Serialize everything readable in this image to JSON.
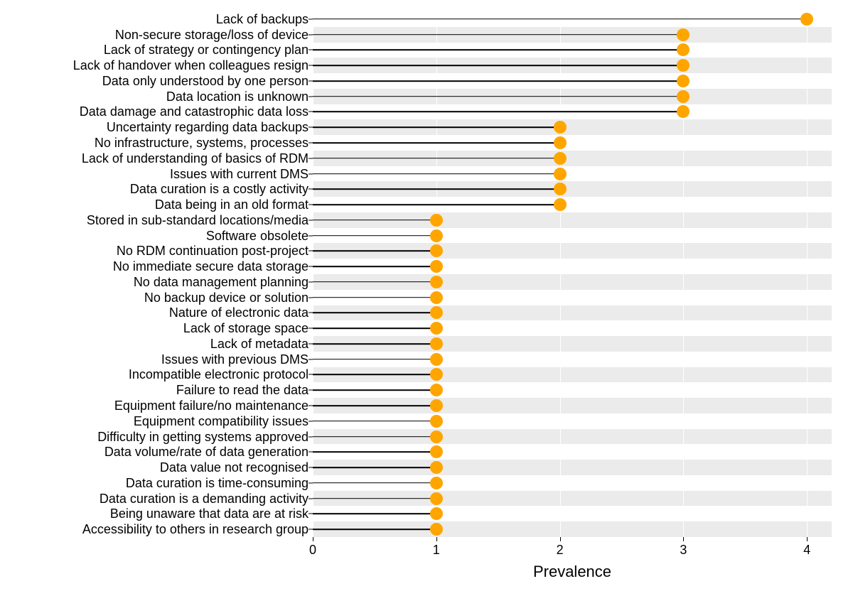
{
  "chart_data": {
    "type": "lollipop-bar",
    "xlabel": "Prevalence",
    "ylabel": "",
    "xlim": [
      0,
      4.2
    ],
    "xticks": [
      0,
      1,
      2,
      3,
      4
    ],
    "series": [
      {
        "label": "Lack of backups",
        "value": 4
      },
      {
        "label": "Non-secure storage/loss of device",
        "value": 3
      },
      {
        "label": "Lack of strategy or contingency plan",
        "value": 3
      },
      {
        "label": "Lack of handover when colleagues resign",
        "value": 3
      },
      {
        "label": "Data only understood by one person",
        "value": 3
      },
      {
        "label": "Data location is unknown",
        "value": 3
      },
      {
        "label": "Data damage and catastrophic data loss",
        "value": 3
      },
      {
        "label": "Uncertainty regarding data backups",
        "value": 2
      },
      {
        "label": "No infrastructure, systems, processes",
        "value": 2
      },
      {
        "label": "Lack of understanding of basics of RDM",
        "value": 2
      },
      {
        "label": "Issues with current DMS",
        "value": 2
      },
      {
        "label": "Data curation is a costly activity",
        "value": 2
      },
      {
        "label": "Data being in an old format",
        "value": 2
      },
      {
        "label": "Stored in sub-standard locations/media",
        "value": 1
      },
      {
        "label": "Software obsolete",
        "value": 1
      },
      {
        "label": "No RDM continuation post-project",
        "value": 1
      },
      {
        "label": "No immediate secure data storage",
        "value": 1
      },
      {
        "label": "No data management planning",
        "value": 1
      },
      {
        "label": "No backup device or solution",
        "value": 1
      },
      {
        "label": "Nature of electronic data",
        "value": 1
      },
      {
        "label": "Lack of storage space",
        "value": 1
      },
      {
        "label": "Lack of metadata",
        "value": 1
      },
      {
        "label": "Issues with previous DMS",
        "value": 1
      },
      {
        "label": "Incompatible electronic protocol",
        "value": 1
      },
      {
        "label": "Failure to read the data",
        "value": 1
      },
      {
        "label": "Equipment failure/no maintenance",
        "value": 1
      },
      {
        "label": "Equipment compatibility issues",
        "value": 1
      },
      {
        "label": "Difficulty in getting systems approved",
        "value": 1
      },
      {
        "label": "Data volume/rate of data generation",
        "value": 1
      },
      {
        "label": "Data value not recognised",
        "value": 1
      },
      {
        "label": "Data curation is time-consuming",
        "value": 1
      },
      {
        "label": "Data curation is a demanding activity",
        "value": 1
      },
      {
        "label": "Being unaware that data are at risk",
        "value": 1
      },
      {
        "label": "Accessibility to others in research group",
        "value": 1
      }
    ],
    "dot_color": "#ffa500",
    "grid_color": "#ebebeb"
  }
}
